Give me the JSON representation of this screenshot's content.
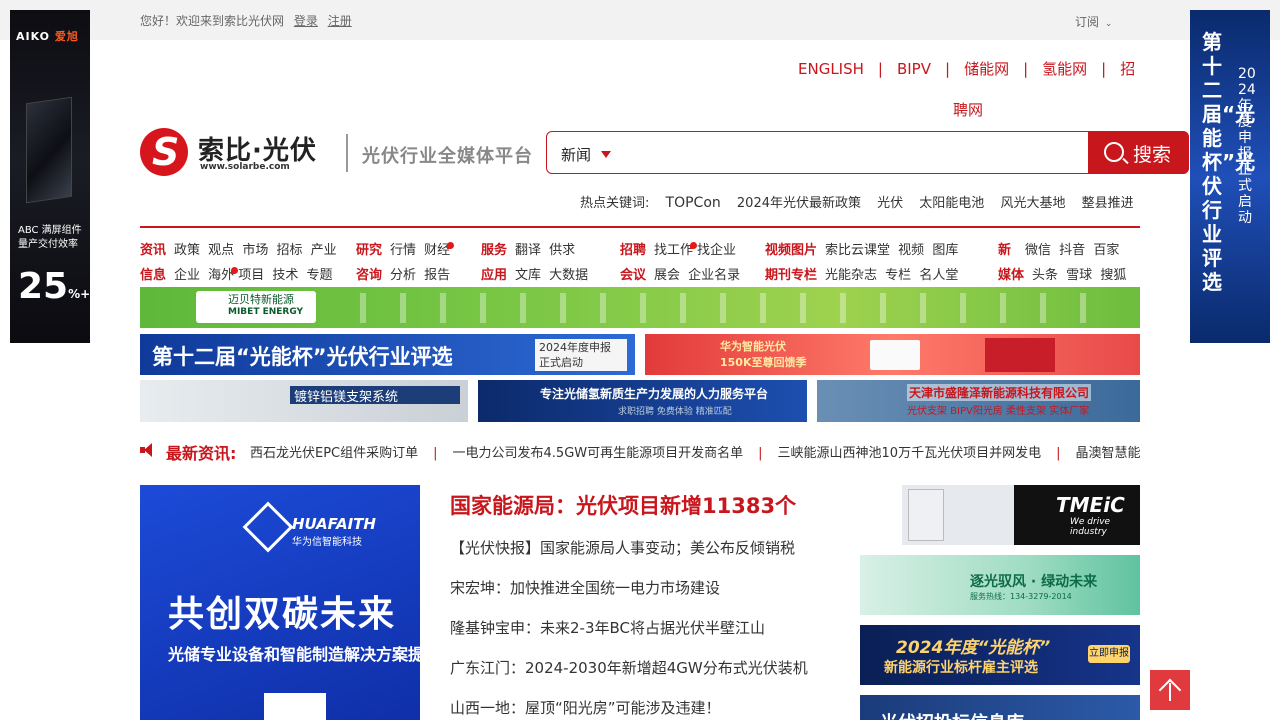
{
  "topbar": {
    "greeting": "您好！欢迎来到索比光伏网",
    "login": "登录",
    "register": "注册",
    "subscribe": "订阅"
  },
  "side_left": {
    "brand": "AIKO",
    "brand_cn": "爱旭",
    "line1": "ABC 满屏组件",
    "line2": "量产交付效率",
    "big": "25",
    "unit": "%+"
  },
  "side_right": {
    "title": "第十二届“光能杯”光伏行业评选",
    "sub": "2024年度申报正式启动"
  },
  "toplinks": [
    "ENGLISH",
    "BIPV",
    "储能网",
    "氢能网",
    "招"
  ],
  "toplinks_wrap": "聘网",
  "logo": {
    "name": "索比·光伏",
    "url": "www.solarbe.com",
    "slogan": "光伏行业全媒体平台"
  },
  "search": {
    "category": "新闻",
    "placeholder": "",
    "button": "搜索"
  },
  "hot_keywords": {
    "label": "热点关键词:",
    "items": [
      "TOPCon",
      "2024年光伏最新政策",
      "光伏",
      "太阳能电池",
      "风光大基地",
      "整县推进"
    ]
  },
  "nav": [
    {
      "rows": [
        {
          "head": "资讯",
          "items": [
            "政策",
            "观点",
            "市场",
            "招标",
            "产业"
          ]
        },
        {
          "head": "信息",
          "items": [
            "企业",
            "海外",
            "项目",
            "技术",
            "专题"
          ]
        }
      ]
    },
    {
      "rows": [
        {
          "head": "研究",
          "items": [
            "行情",
            "财经"
          ]
        },
        {
          "head": "咨询",
          "items": [
            "分析",
            "报告"
          ]
        }
      ]
    },
    {
      "rows": [
        {
          "head": "服务",
          "items": [
            "翻译",
            "供求"
          ]
        },
        {
          "head": "应用",
          "items": [
            "文库",
            "大数据"
          ]
        }
      ]
    },
    {
      "rows": [
        {
          "head": "招聘",
          "items": [
            "找工作",
            "找企业"
          ]
        },
        {
          "head": "会议",
          "items": [
            "展会",
            "企业名录"
          ]
        }
      ]
    },
    {
      "rows": [
        {
          "head": "视频图片",
          "items": [
            "索比云课堂",
            "视频",
            "图库"
          ]
        },
        {
          "head": "期刊专栏",
          "items": [
            "光能杂志",
            "专栏",
            "名人堂"
          ]
        }
      ]
    },
    {
      "rows": [
        {
          "head": "新",
          "items": [
            "微信",
            "抖音",
            "百家"
          ]
        },
        {
          "head": "媒体",
          "items": [
            "头条",
            "雪球",
            "搜狐"
          ]
        }
      ]
    }
  ],
  "banners": {
    "green_brand": "迈贝特新能源",
    "green_brand_en": "MIBET ENERGY",
    "b1_title": "第十二届“光能杯”光伏行业评选",
    "b1_tag1": "2024年度申报",
    "b1_tag2": "正式启动",
    "b2_title": "华为智能光伏",
    "b2_sub": "150K至尊回馈季",
    "b3_title": "镀锌铝镁支架系统",
    "b4_title": "专注光储氢新质生产力发展的人力服务平台",
    "b4_sub": "求职招聘  免费体验  精准匹配",
    "b5_title": "天津市盛隆泽新能源科技有限公司",
    "b5_sub": "光伏支架 BIPV阳光房 柔性支架 实体厂家"
  },
  "news": {
    "label": "最新资讯:",
    "items": [
      "西石龙光伏EPC组件采购订单",
      "一电力公司发布4.5GW可再生能源项目开发商名单",
      "三峡能源山西神池10万千瓦光伏项目并网发电",
      "晶澳智慧能"
    ]
  },
  "main_ad": {
    "brand": "HUAFAITH",
    "brand_cn": "华为信智能科技",
    "headline": "共创双碳未来",
    "sub": "光储专业设备和智能制造解决方案提"
  },
  "headlines": {
    "top": "国家能源局：光伏项目新增11383个",
    "items": [
      "【光伏快报】国家能源局人事变动；美公布反倾销税",
      "宋宏坤：加快推进全国统一电力市场建设",
      "隆基钟宝申：未来2-3年BC将占据光伏半壁江山",
      "广东江门：2024-2030年新增超4GW分布式光伏装机",
      "山西一地：屋顶“阳光房”可能涉及违建！"
    ]
  },
  "right_ads": {
    "ra1_logo": "TMEiC",
    "ra1_sub": "We drive industry",
    "ra2_title": "逐光驭风 · 绿动未来",
    "ra2_sub": "服务热线：134-3279-2014",
    "ra3_title": "2024年度“光能杯”",
    "ra3_sub": "新能源行业标杆雇主评选",
    "ra3_btn": "立即申报",
    "ra4_title": "光伏招投标信息库"
  },
  "colors": {
    "accent": "#c8161d",
    "topbar_bg": "#f2f2f2"
  }
}
